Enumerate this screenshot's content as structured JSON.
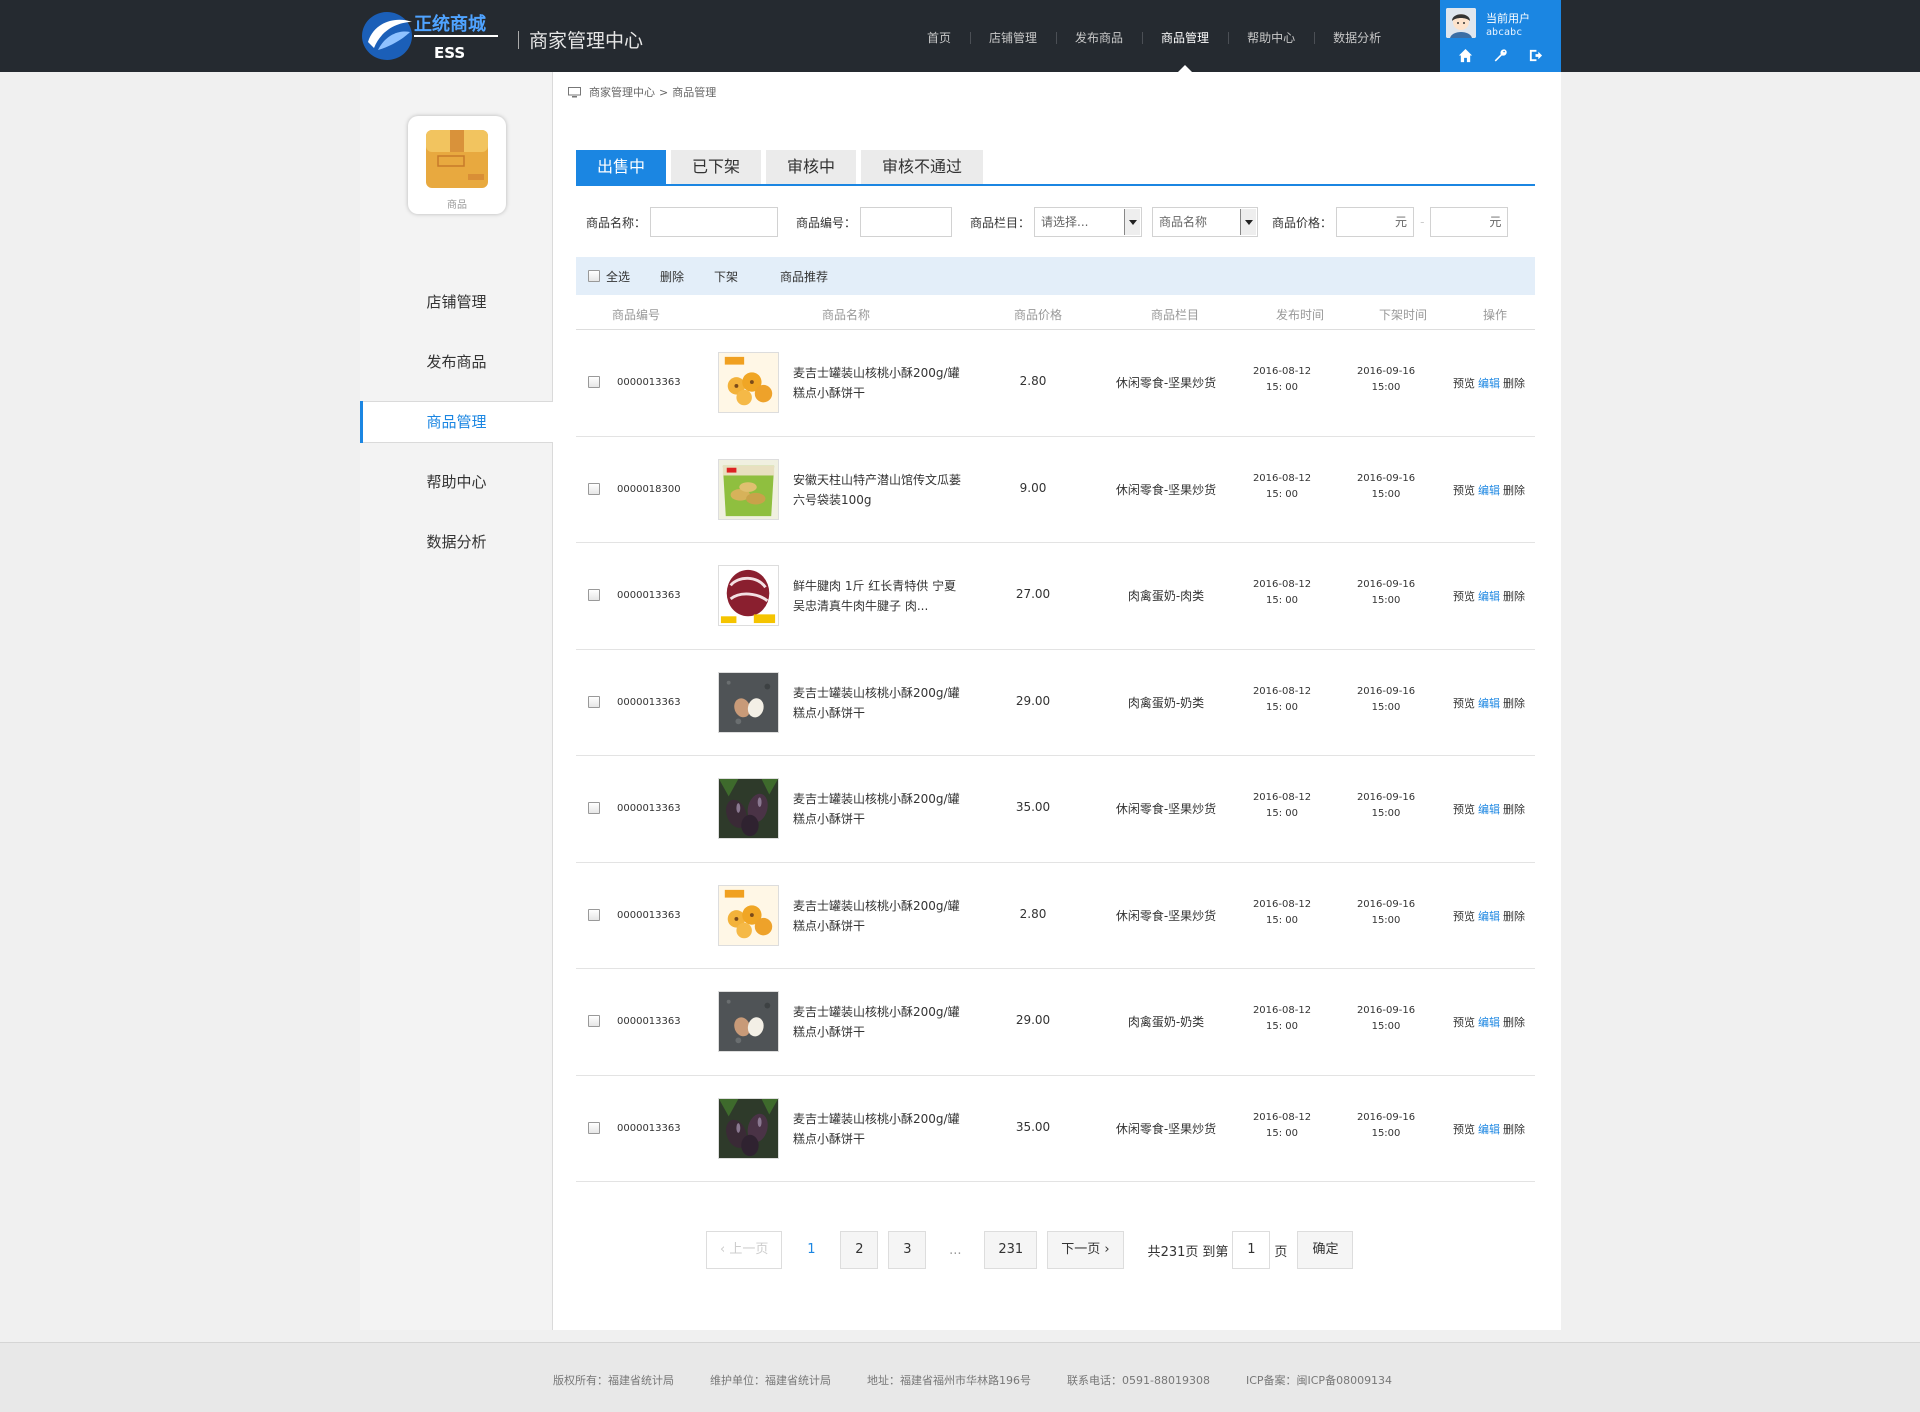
{
  "header": {
    "logo_text": "正统商城",
    "logo_sub": "ESS",
    "title": "商家管理中心",
    "nav": [
      "首页",
      "店铺管理",
      "发布商品",
      "商品管理",
      "帮助中心",
      "数据分析"
    ],
    "active_nav": "商品管理",
    "user": {
      "label": "当前用户",
      "name": "abcabc",
      "icons": [
        "home-icon",
        "wrench-icon",
        "logout-icon"
      ]
    }
  },
  "sidebar": {
    "tile_label": "商品",
    "items": [
      "店铺管理",
      "发布商品",
      "商品管理",
      "帮助中心",
      "数据分析"
    ],
    "active": "商品管理"
  },
  "breadcrumb": {
    "root": "商家管理中心",
    "sep": ">",
    "current": "商品管理"
  },
  "tabs": [
    "出售中",
    "已下架",
    "审核中",
    "审核不通过"
  ],
  "filters": {
    "name_label": "商品名称：",
    "code_label": "商品编号：",
    "column_label": "商品栏目：",
    "column_select": "请选择...",
    "name_select": "商品名称",
    "price_label": "商品价格：",
    "price_unit": "元",
    "price_sep": "-"
  },
  "actions": {
    "select_all": "全选",
    "delete": "删除",
    "off_shelf": "下架",
    "recommend": "商品推荐"
  },
  "table": {
    "headers": [
      "商品编号",
      "商品名称",
      "商品价格",
      "商品栏目",
      "发布时间",
      "下架时间",
      "操作"
    ],
    "ops": {
      "preview": "预览",
      "edit": "编辑",
      "delete": "删除"
    },
    "rows": [
      {
        "code": "0000013363",
        "name": "麦吉士罐装山核桃小酥200g/罐糕点小酥饼干",
        "price": "2.80",
        "category": "休闲零食-坚果炒货",
        "publish_date": "2016-08-12",
        "publish_time": "15: 00",
        "off_date": "2016-09-16",
        "off_time": "15:00",
        "thumb": "cookies"
      },
      {
        "code": "0000018300",
        "name": "安徽天柱山特产潜山馆传文瓜蒌六号袋装100g",
        "price": "9.00",
        "category": "休闲零食-坚果炒货",
        "publish_date": "2016-08-12",
        "publish_time": "15: 00",
        "off_date": "2016-09-16",
        "off_time": "15:00",
        "thumb": "seeds"
      },
      {
        "code": "0000013363",
        "name": "鲜牛腱肉 1斤 红长青特供 宁夏吴忠清真牛肉牛腱子 肉...",
        "price": "27.00",
        "category": "肉禽蛋奶-肉类",
        "publish_date": "2016-08-12",
        "publish_time": "15: 00",
        "off_date": "2016-09-16",
        "off_time": "15:00",
        "thumb": "meat"
      },
      {
        "code": "0000013363",
        "name": "麦吉士罐装山核桃小酥200g/罐糕点小酥饼干",
        "price": "29.00",
        "category": "肉禽蛋奶-奶类",
        "publish_date": "2016-08-12",
        "publish_time": "15: 00",
        "off_date": "2016-09-16",
        "off_time": "15:00",
        "thumb": "eggs"
      },
      {
        "code": "0000013363",
        "name": "麦吉士罐装山核桃小酥200g/罐糕点小酥饼干",
        "price": "35.00",
        "category": "休闲零食-坚果炒货",
        "publish_date": "2016-08-12",
        "publish_time": "15: 00",
        "off_date": "2016-09-16",
        "off_time": "15:00",
        "thumb": "eggplant"
      },
      {
        "code": "0000013363",
        "name": "麦吉士罐装山核桃小酥200g/罐糕点小酥饼干",
        "price": "2.80",
        "category": "休闲零食-坚果炒货",
        "publish_date": "2016-08-12",
        "publish_time": "15: 00",
        "off_date": "2016-09-16",
        "off_time": "15:00",
        "thumb": "cookies"
      },
      {
        "code": "0000013363",
        "name": "麦吉士罐装山核桃小酥200g/罐糕点小酥饼干",
        "price": "29.00",
        "category": "肉禽蛋奶-奶类",
        "publish_date": "2016-08-12",
        "publish_time": "15: 00",
        "off_date": "2016-09-16",
        "off_time": "15:00",
        "thumb": "eggs"
      },
      {
        "code": "0000013363",
        "name": "麦吉士罐装山核桃小酥200g/罐糕点小酥饼干",
        "price": "35.00",
        "category": "休闲零食-坚果炒货",
        "publish_date": "2016-08-12",
        "publish_time": "15: 00",
        "off_date": "2016-09-16",
        "off_time": "15:00",
        "thumb": "eggplant"
      }
    ]
  },
  "pager": {
    "prev": "上一页",
    "pages": [
      "1",
      "2",
      "3"
    ],
    "dots": "...",
    "last": "231",
    "next": "下一页",
    "total_prefix": "共",
    "total": "231",
    "total_suffix": "页",
    "goto": "到第",
    "current": "1",
    "page_unit": "页",
    "confirm": "确定"
  },
  "footer": [
    "版权所有：福建省统计局",
    "维护单位：福建省统计局",
    "地址：福建省福州市华林路196号",
    "联系电话：0591-88019308",
    "ICP备案：闽ICP备08009134"
  ],
  "colors": {
    "accent": "#1b86e2",
    "header_bg": "#252a30"
  }
}
